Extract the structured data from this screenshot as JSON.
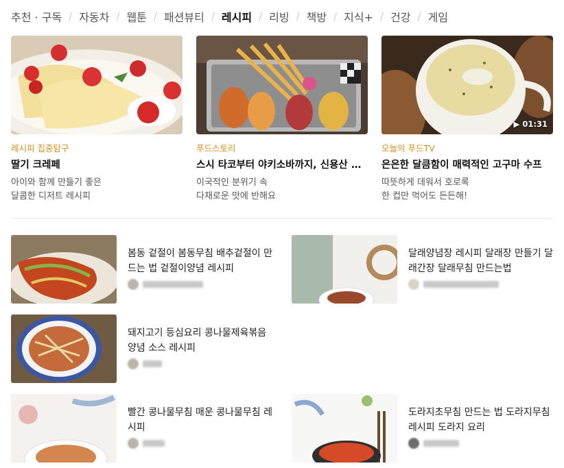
{
  "tabs": [
    {
      "label": "추천 · 구독",
      "active": false
    },
    {
      "label": "자동차",
      "active": false
    },
    {
      "label": "웹툰",
      "active": false
    },
    {
      "label": "패션뷰티",
      "active": false
    },
    {
      "label": "레시피",
      "active": true
    },
    {
      "label": "리빙",
      "active": false
    },
    {
      "label": "책방",
      "active": false
    },
    {
      "label": "지식+",
      "active": false
    },
    {
      "label": "건강",
      "active": false
    },
    {
      "label": "게임",
      "active": false
    }
  ],
  "cards": [
    {
      "category": "레시피 집중탐구",
      "title": "딸기 크레페",
      "desc1": "아이와 함께 만들기 좋은",
      "desc2": "달콤한 디저트 레시피",
      "duration": ""
    },
    {
      "category": "푸드스토리",
      "title": "스시 타코부터 야키소바까지, 신용산 레스토랑",
      "desc1": "이국적인 분위기 속",
      "desc2": "다채로운 맛에 반해요",
      "duration": ""
    },
    {
      "category": "오늘의 푸드TV",
      "title": "은은한 달큼함이 매력적인 고구마 수프",
      "desc1": "따뜻하게 데워서 호로록",
      "desc2": "한 컵만 먹어도 든든해!",
      "duration": "▶ 01:31"
    }
  ],
  "list": [
    {
      "title": "봄동 겉절이 봄동무침 배추겉절이 만드는 법 겉절이양념 레시피"
    },
    {
      "title": "달래양념장 레시피 달래장 만들기 달래간장 달래무침 만드는법"
    },
    {
      "title": "돼지고기 등심요리 콩나물제육볶음 양념 소스 레시피"
    },
    {
      "title": "빨간 콩나물무침 매운 콩나물무침 레시피"
    },
    {
      "title": "도라지초무침 만드는 법 도라지무침 레시피 도라지 요리"
    }
  ],
  "colors": {
    "category": "#d4931c",
    "active_tab": "#111111",
    "divider": "#e8e8e8"
  }
}
